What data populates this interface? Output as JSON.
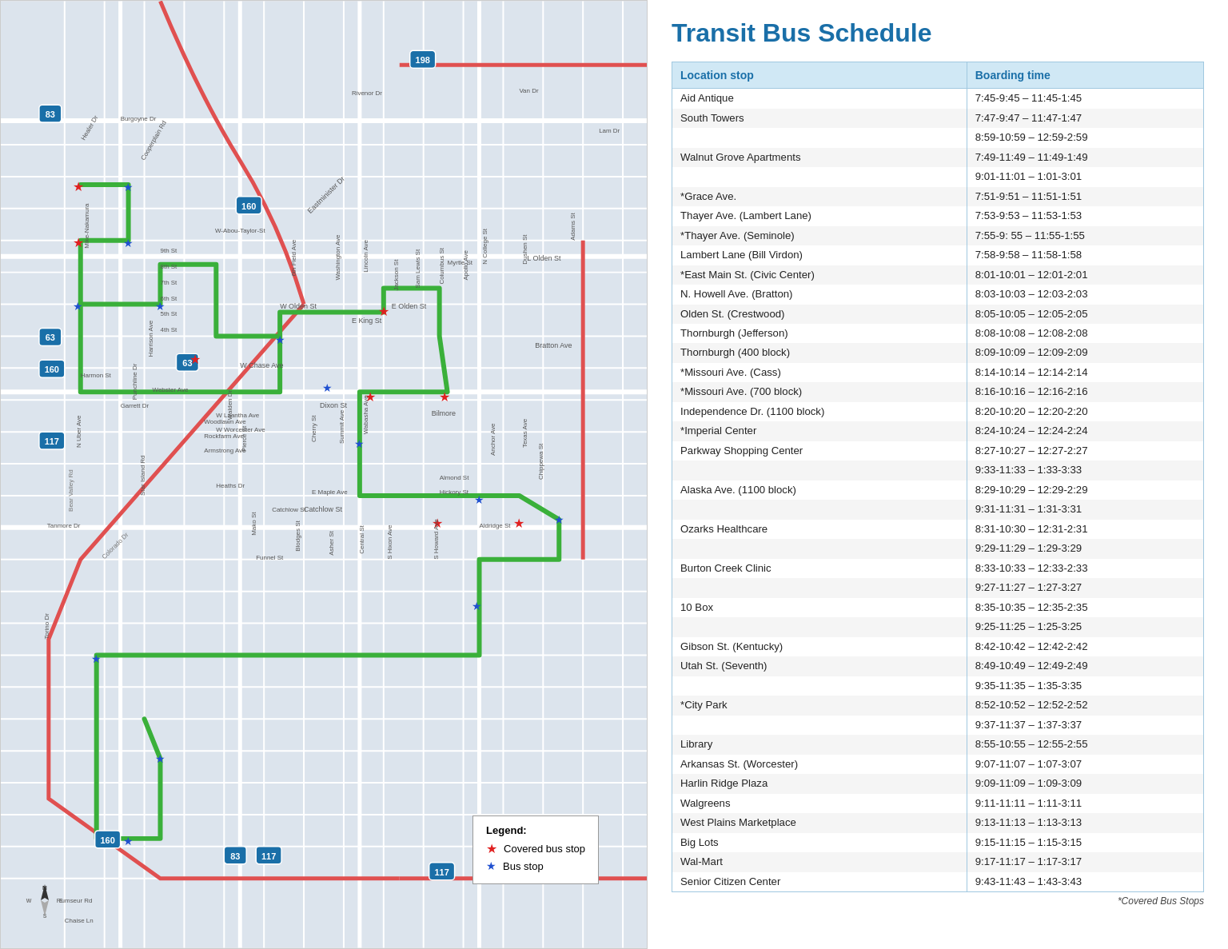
{
  "title": "Transit Bus Schedule",
  "schedule": {
    "col_location": "Location stop",
    "col_boarding": "Boarding time",
    "rows": [
      {
        "location": "Aid Antique",
        "time": "7:45-9:45 – 11:45-1:45",
        "indent": false
      },
      {
        "location": "South Towers",
        "time": "7:47-9:47 – 11:47-1:47",
        "indent": false
      },
      {
        "location": "",
        "time": "8:59-10:59 – 12:59-2:59",
        "indent": false
      },
      {
        "location": "Walnut Grove Apartments",
        "time": "7:49-11:49 – 11:49-1:49",
        "indent": false
      },
      {
        "location": "",
        "time": "9:01-11:01 – 1:01-3:01",
        "indent": false
      },
      {
        "location": "*Grace Ave.",
        "time": "7:51-9:51 – 11:51-1:51",
        "indent": false
      },
      {
        "location": "Thayer Ave. (Lambert Lane)",
        "time": "7:53-9:53 – 11:53-1:53",
        "indent": false
      },
      {
        "location": "*Thayer Ave. (Seminole)",
        "time": "7:55-9: 55 – 11:55-1:55",
        "indent": false
      },
      {
        "location": "Lambert Lane (Bill Virdon)",
        "time": "7:58-9:58 – 11:58-1:58",
        "indent": false
      },
      {
        "location": "*East Main St. (Civic Center)",
        "time": "8:01-10:01 – 12:01-2:01",
        "indent": false
      },
      {
        "location": "N. Howell Ave. (Bratton)",
        "time": "8:03-10:03 – 12:03-2:03",
        "indent": false
      },
      {
        "location": "Olden St. (Crestwood)",
        "time": "8:05-10:05 – 12:05-2:05",
        "indent": false
      },
      {
        "location": "Thornburgh (Jefferson)",
        "time": "8:08-10:08 – 12:08-2:08",
        "indent": false
      },
      {
        "location": "Thornburgh (400 block)",
        "time": "8:09-10:09 – 12:09-2:09",
        "indent": false
      },
      {
        "location": "*Missouri Ave. (Cass)",
        "time": "8:14-10:14 – 12:14-2:14",
        "indent": false
      },
      {
        "location": "*Missouri Ave. (700 block)",
        "time": "8:16-10:16 – 12:16-2:16",
        "indent": false
      },
      {
        "location": "Independence Dr. (1100 block)",
        "time": "8:20-10:20 – 12:20-2:20",
        "indent": false
      },
      {
        "location": "*Imperial Center",
        "time": "8:24-10:24 – 12:24-2:24",
        "indent": false
      },
      {
        "location": "Parkway Shopping Center",
        "time": "8:27-10:27 – 12:27-2:27",
        "indent": false
      },
      {
        "location": "",
        "time": "9:33-11:33 – 1:33-3:33",
        "indent": false
      },
      {
        "location": "Alaska Ave. (1100 block)",
        "time": "8:29-10:29 – 12:29-2:29",
        "indent": false
      },
      {
        "location": "",
        "time": "9:31-11:31 – 1:31-3:31",
        "indent": false
      },
      {
        "location": "Ozarks Healthcare",
        "time": "8:31-10:30 – 12:31-2:31",
        "indent": false
      },
      {
        "location": "",
        "time": "9:29-11:29 – 1:29-3:29",
        "indent": false
      },
      {
        "location": "Burton Creek Clinic",
        "time": "8:33-10:33 – 12:33-2:33",
        "indent": false
      },
      {
        "location": "",
        "time": "9:27-11:27 – 1:27-3:27",
        "indent": false
      },
      {
        "location": "10 Box",
        "time": "8:35-10:35 – 12:35-2:35",
        "indent": false
      },
      {
        "location": "",
        "time": "9:25-11:25 – 1:25-3:25",
        "indent": false
      },
      {
        "location": "Gibson St. (Kentucky)",
        "time": "8:42-10:42 – 12:42-2:42",
        "indent": false
      },
      {
        "location": "Utah St. (Seventh)",
        "time": "8:49-10:49 – 12:49-2:49",
        "indent": false
      },
      {
        "location": "",
        "time": "9:35-11:35 – 1:35-3:35",
        "indent": false
      },
      {
        "location": "*City Park",
        "time": "8:52-10:52 – 12:52-2:52",
        "indent": false
      },
      {
        "location": "",
        "time": "9:37-11:37 – 1:37-3:37",
        "indent": false
      },
      {
        "location": "Library",
        "time": "8:55-10:55 – 12:55-2:55",
        "indent": false
      },
      {
        "location": "Arkansas St. (Worcester)",
        "time": "9:07-11:07 – 1:07-3:07",
        "indent": false
      },
      {
        "location": "Harlin Ridge Plaza",
        "time": "9:09-11:09 – 1:09-3:09",
        "indent": false
      },
      {
        "location": "Walgreens",
        "time": "9:11-11:11 – 1:11-3:11",
        "indent": false
      },
      {
        "location": "West Plains Marketplace",
        "time": "9:13-11:13 – 1:13-3:13",
        "indent": false
      },
      {
        "location": "Big Lots",
        "time": "9:15-11:15 – 1:15-3:15",
        "indent": false
      },
      {
        "location": "Wal-Mart",
        "time": "9:17-11:17 – 1:17-3:17",
        "indent": false
      },
      {
        "location": "Senior Citizen Center",
        "time": "9:43-11:43 – 1:43-3:43",
        "indent": false
      }
    ],
    "footnote": "*Covered Bus Stops"
  },
  "legend": {
    "title": "Legend:",
    "items": [
      {
        "label": "Covered bus stop",
        "type": "star-red"
      },
      {
        "label": "Bus stop",
        "type": "star-blue"
      }
    ]
  },
  "map": {
    "route_numbers": [
      "83",
      "160",
      "117",
      "198",
      "63",
      "160"
    ]
  }
}
